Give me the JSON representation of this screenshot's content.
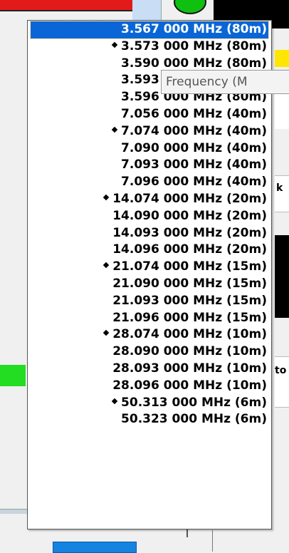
{
  "background": {
    "side_text_1": "k",
    "side_text_2": "to"
  },
  "tooltip": {
    "text": "Frequency (M"
  },
  "dropdown": {
    "items": [
      {
        "label": "3.567 000 MHz (80m)",
        "selected": true,
        "marked": false
      },
      {
        "label": "3.573 000 MHz (80m)",
        "selected": false,
        "marked": true
      },
      {
        "label": "3.590 000 MHz (80m)",
        "selected": false,
        "marked": false
      },
      {
        "label": "3.593 000 MHz (80m)",
        "selected": false,
        "marked": false
      },
      {
        "label": "3.596 000 MHz (80m)",
        "selected": false,
        "marked": false
      },
      {
        "label": "7.056 000 MHz (40m)",
        "selected": false,
        "marked": false
      },
      {
        "label": "7.074 000 MHz (40m)",
        "selected": false,
        "marked": true
      },
      {
        "label": "7.090 000 MHz (40m)",
        "selected": false,
        "marked": false
      },
      {
        "label": "7.093 000 MHz (40m)",
        "selected": false,
        "marked": false
      },
      {
        "label": "7.096 000 MHz (40m)",
        "selected": false,
        "marked": false
      },
      {
        "label": "14.074 000 MHz (20m)",
        "selected": false,
        "marked": true
      },
      {
        "label": "14.090 000 MHz (20m)",
        "selected": false,
        "marked": false
      },
      {
        "label": "14.093 000 MHz (20m)",
        "selected": false,
        "marked": false
      },
      {
        "label": "14.096 000 MHz (20m)",
        "selected": false,
        "marked": false
      },
      {
        "label": "21.074 000 MHz (15m)",
        "selected": false,
        "marked": true
      },
      {
        "label": "21.090 000 MHz (15m)",
        "selected": false,
        "marked": false
      },
      {
        "label": "21.093 000 MHz (15m)",
        "selected": false,
        "marked": false
      },
      {
        "label": "21.096 000 MHz (15m)",
        "selected": false,
        "marked": false
      },
      {
        "label": "28.074 000 MHz (10m)",
        "selected": false,
        "marked": true
      },
      {
        "label": "28.090 000 MHz (10m)",
        "selected": false,
        "marked": false
      },
      {
        "label": "28.093 000 MHz (10m)",
        "selected": false,
        "marked": false
      },
      {
        "label": "28.096 000 MHz (10m)",
        "selected": false,
        "marked": false
      },
      {
        "label": "50.313 000 MHz (6m)",
        "selected": false,
        "marked": true
      },
      {
        "label": "50.323 000 MHz (6m)",
        "selected": false,
        "marked": false
      }
    ]
  },
  "colors": {
    "selection": "#0a66d6",
    "selection_text": "#ffffff",
    "item_text": "#000000"
  }
}
